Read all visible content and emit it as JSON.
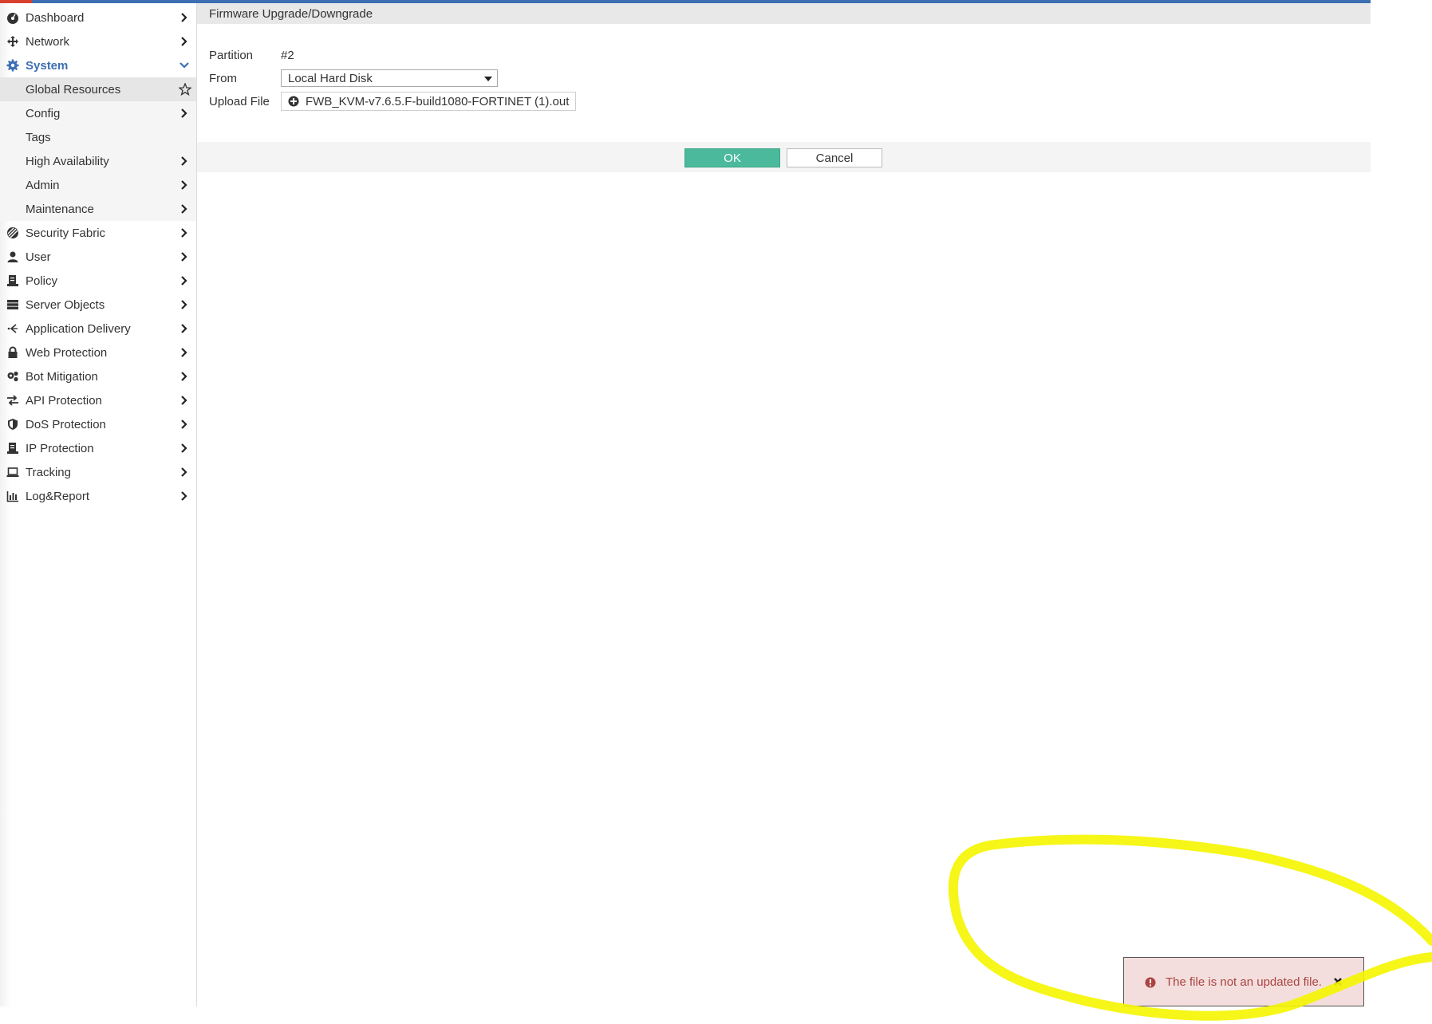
{
  "sidebar": {
    "items": [
      {
        "label": "Dashboard",
        "icon": "dashboard-icon"
      },
      {
        "label": "Network",
        "icon": "network-icon"
      },
      {
        "label": "System",
        "icon": "gear-icon"
      },
      {
        "label": "Global Resources"
      },
      {
        "label": "Config"
      },
      {
        "label": "Tags"
      },
      {
        "label": "High Availability"
      },
      {
        "label": "Admin"
      },
      {
        "label": "Maintenance"
      },
      {
        "label": "Security Fabric",
        "icon": "security-fabric-icon"
      },
      {
        "label": "User",
        "icon": "user-icon"
      },
      {
        "label": "Policy",
        "icon": "policy-icon"
      },
      {
        "label": "Server Objects",
        "icon": "server-objects-icon"
      },
      {
        "label": "Application Delivery",
        "icon": "application-delivery-icon"
      },
      {
        "label": "Web Protection",
        "icon": "lock-icon"
      },
      {
        "label": "Bot Mitigation",
        "icon": "bot-icon"
      },
      {
        "label": "API Protection",
        "icon": "api-arrows-icon"
      },
      {
        "label": "DoS Protection",
        "icon": "shield-icon"
      },
      {
        "label": "IP Protection",
        "icon": "ip-protection-icon"
      },
      {
        "label": "Tracking",
        "icon": "laptop-icon"
      },
      {
        "label": "Log&Report",
        "icon": "bar-chart-icon"
      }
    ]
  },
  "main": {
    "title": "Firmware Upgrade/Downgrade",
    "form": {
      "partition_label": "Partition",
      "partition_value": "#2",
      "from_label": "From",
      "from_value": "Local Hard Disk",
      "upload_label": "Upload File",
      "upload_value": "FWB_KVM-v7.6.5.F-build1080-FORTINET (1).out"
    },
    "buttons": {
      "ok": "OK",
      "cancel": "Cancel"
    }
  },
  "toast": {
    "message": "The file is not an updated file."
  },
  "colors": {
    "accent": "#3d6fb3",
    "ok_button": "#4bb99b",
    "error_text": "#a94442",
    "annotation": "#f5f500"
  }
}
